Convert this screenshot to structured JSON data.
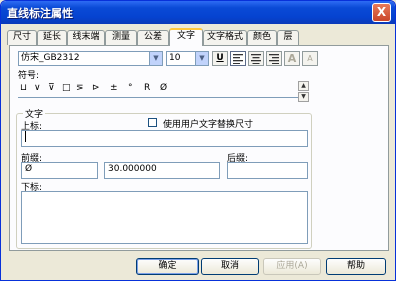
{
  "window": {
    "title": "直线标注属性",
    "close_label": "X"
  },
  "tabs": [
    {
      "label": "尺寸"
    },
    {
      "label": "延长"
    },
    {
      "label": "线末端"
    },
    {
      "label": "测量"
    },
    {
      "label": "公差"
    },
    {
      "label": "文字",
      "active": true
    },
    {
      "label": "文字格式"
    },
    {
      "label": "颜色"
    },
    {
      "label": "层"
    }
  ],
  "font": {
    "name": "仿宋_GB2312",
    "size": "10"
  },
  "format_buttons": {
    "underline": "U",
    "grow": "A",
    "shrink": "A"
  },
  "symbols": {
    "label": "符号:",
    "items": [
      "⊔",
      "∨",
      "⊽",
      "□",
      "⋝",
      "⊳",
      "±",
      "°",
      "R",
      "Ø"
    ]
  },
  "text_group": {
    "legend": "文字",
    "superscript_label": "上标:",
    "superscript_value": "",
    "override_checkbox_label": "使用用户文字替换尺寸",
    "override_checked": false,
    "prefix_label": "前缀:",
    "prefix_value": "Ø",
    "dimension_value": "30.000000",
    "suffix_label": "后缀:",
    "suffix_value": "",
    "subscript_label": "下标:",
    "subscript_value": ""
  },
  "buttons": {
    "ok": "确定",
    "cancel": "取消",
    "apply": "应用(A)",
    "help": "帮助"
  }
}
